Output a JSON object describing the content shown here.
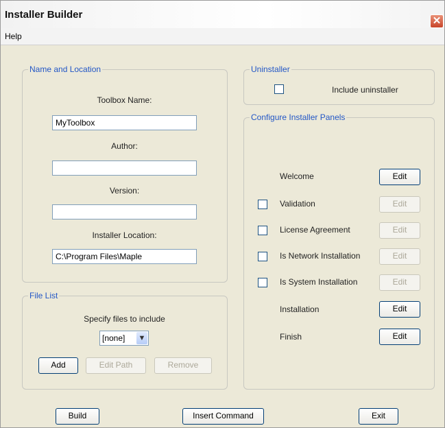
{
  "window": {
    "title": "Installer Builder",
    "close_glyph": "✕"
  },
  "menu": {
    "help": "Help"
  },
  "name_location": {
    "legend": "Name and Location",
    "toolbox_label": "Toolbox Name:",
    "toolbox_value": "MyToolbox",
    "author_label": "Author:",
    "author_value": "",
    "version_label": "Version:",
    "version_value": "",
    "location_label": "Installer Location:",
    "location_value": "C:\\Program Files\\Maple"
  },
  "file_list": {
    "legend": "File List",
    "prompt": "Specify files to include",
    "selected": "[none]",
    "add": "Add",
    "edit_path": "Edit Path",
    "remove": "Remove"
  },
  "uninstaller": {
    "legend": "Uninstaller",
    "include_label": "Include uninstaller",
    "checked": false
  },
  "panels": {
    "legend": "Configure Installer Panels",
    "edit_label": "Edit",
    "items": [
      {
        "label": "Welcome",
        "has_checkbox": false,
        "edit_enabled": true
      },
      {
        "label": "Validation",
        "has_checkbox": true,
        "edit_enabled": false
      },
      {
        "label": "License Agreement",
        "has_checkbox": true,
        "edit_enabled": false
      },
      {
        "label": "Is Network Installation",
        "has_checkbox": true,
        "edit_enabled": false
      },
      {
        "label": "Is System Installation",
        "has_checkbox": true,
        "edit_enabled": false
      },
      {
        "label": "Installation",
        "has_checkbox": false,
        "edit_enabled": true
      },
      {
        "label": "Finish",
        "has_checkbox": false,
        "edit_enabled": true
      }
    ]
  },
  "footer": {
    "build": "Build",
    "insert_command": "Insert Command",
    "exit": "Exit"
  }
}
